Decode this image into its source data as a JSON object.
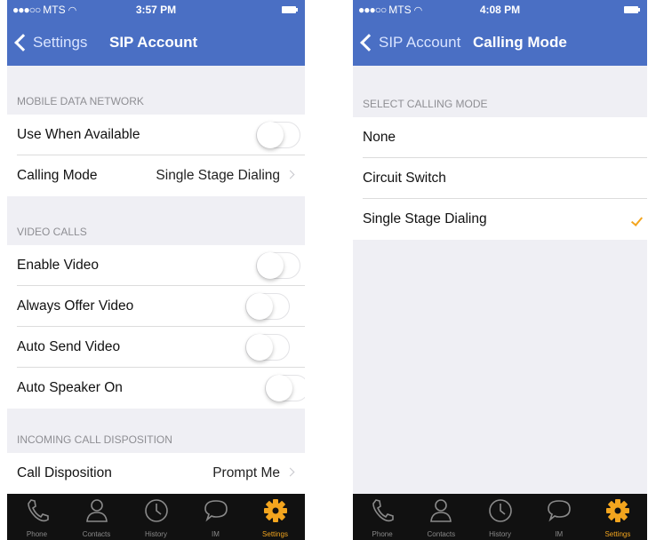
{
  "left": {
    "status": {
      "carrier": "MTS",
      "time": "3:57 PM"
    },
    "nav": {
      "back_label": "Settings",
      "title": "SIP Account"
    },
    "sections": [
      {
        "header": "MOBILE DATA NETWORK",
        "rows": [
          {
            "label": "Use When Available",
            "control": "switch",
            "on": false
          },
          {
            "label": "Calling Mode",
            "value": "Single Stage Dialing",
            "control": "disclosure"
          }
        ]
      },
      {
        "header": "VIDEO CALLS",
        "rows": [
          {
            "label": "Enable Video",
            "control": "switch",
            "on": false
          },
          {
            "label": "Always Offer Video",
            "control": "switch",
            "on": false
          },
          {
            "label": "Auto Send Video",
            "control": "switch",
            "on": false
          },
          {
            "label": "Auto Speaker On",
            "control": "switch",
            "on": false
          }
        ]
      },
      {
        "header": "INCOMING CALL DISPOSITION",
        "rows": [
          {
            "label": "Call Disposition",
            "value": "Prompt Me",
            "control": "disclosure"
          }
        ]
      }
    ]
  },
  "right": {
    "status": {
      "carrier": "MTS",
      "time": "4:08 PM"
    },
    "nav": {
      "back_label": "SIP Account",
      "title": "Calling Mode"
    },
    "section_header": "SELECT CALLING MODE",
    "options": [
      {
        "label": "None",
        "selected": false
      },
      {
        "label": "Circuit Switch",
        "selected": false
      },
      {
        "label": "Single Stage Dialing",
        "selected": true
      }
    ]
  },
  "tabs": [
    {
      "label": "Phone",
      "icon": "phone-icon"
    },
    {
      "label": "Contacts",
      "icon": "contacts-icon"
    },
    {
      "label": "History",
      "icon": "clock-icon"
    },
    {
      "label": "IM",
      "icon": "chat-bubble-icon"
    },
    {
      "label": "Settings",
      "icon": "gear-icon",
      "active": true
    }
  ],
  "colors": {
    "navbar": "#4a6fc4",
    "accent": "#f3a51e",
    "tabbar": "#111111",
    "background": "#efeff4"
  }
}
